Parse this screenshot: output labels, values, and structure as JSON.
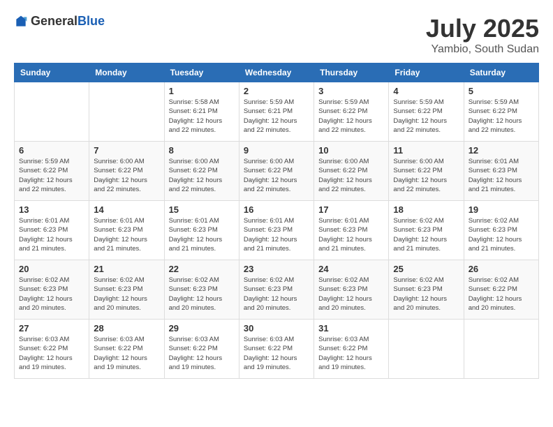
{
  "header": {
    "logo_general": "General",
    "logo_blue": "Blue",
    "title": "July 2025",
    "location": "Yambio, South Sudan"
  },
  "weekdays": [
    "Sunday",
    "Monday",
    "Tuesday",
    "Wednesday",
    "Thursday",
    "Friday",
    "Saturday"
  ],
  "weeks": [
    [
      {
        "day": "",
        "info": ""
      },
      {
        "day": "",
        "info": ""
      },
      {
        "day": "1",
        "info": "Sunrise: 5:58 AM\nSunset: 6:21 PM\nDaylight: 12 hours and 22 minutes."
      },
      {
        "day": "2",
        "info": "Sunrise: 5:59 AM\nSunset: 6:21 PM\nDaylight: 12 hours and 22 minutes."
      },
      {
        "day": "3",
        "info": "Sunrise: 5:59 AM\nSunset: 6:22 PM\nDaylight: 12 hours and 22 minutes."
      },
      {
        "day": "4",
        "info": "Sunrise: 5:59 AM\nSunset: 6:22 PM\nDaylight: 12 hours and 22 minutes."
      },
      {
        "day": "5",
        "info": "Sunrise: 5:59 AM\nSunset: 6:22 PM\nDaylight: 12 hours and 22 minutes."
      }
    ],
    [
      {
        "day": "6",
        "info": "Sunrise: 5:59 AM\nSunset: 6:22 PM\nDaylight: 12 hours and 22 minutes."
      },
      {
        "day": "7",
        "info": "Sunrise: 6:00 AM\nSunset: 6:22 PM\nDaylight: 12 hours and 22 minutes."
      },
      {
        "day": "8",
        "info": "Sunrise: 6:00 AM\nSunset: 6:22 PM\nDaylight: 12 hours and 22 minutes."
      },
      {
        "day": "9",
        "info": "Sunrise: 6:00 AM\nSunset: 6:22 PM\nDaylight: 12 hours and 22 minutes."
      },
      {
        "day": "10",
        "info": "Sunrise: 6:00 AM\nSunset: 6:22 PM\nDaylight: 12 hours and 22 minutes."
      },
      {
        "day": "11",
        "info": "Sunrise: 6:00 AM\nSunset: 6:22 PM\nDaylight: 12 hours and 22 minutes."
      },
      {
        "day": "12",
        "info": "Sunrise: 6:01 AM\nSunset: 6:23 PM\nDaylight: 12 hours and 21 minutes."
      }
    ],
    [
      {
        "day": "13",
        "info": "Sunrise: 6:01 AM\nSunset: 6:23 PM\nDaylight: 12 hours and 21 minutes."
      },
      {
        "day": "14",
        "info": "Sunrise: 6:01 AM\nSunset: 6:23 PM\nDaylight: 12 hours and 21 minutes."
      },
      {
        "day": "15",
        "info": "Sunrise: 6:01 AM\nSunset: 6:23 PM\nDaylight: 12 hours and 21 minutes."
      },
      {
        "day": "16",
        "info": "Sunrise: 6:01 AM\nSunset: 6:23 PM\nDaylight: 12 hours and 21 minutes."
      },
      {
        "day": "17",
        "info": "Sunrise: 6:01 AM\nSunset: 6:23 PM\nDaylight: 12 hours and 21 minutes."
      },
      {
        "day": "18",
        "info": "Sunrise: 6:02 AM\nSunset: 6:23 PM\nDaylight: 12 hours and 21 minutes."
      },
      {
        "day": "19",
        "info": "Sunrise: 6:02 AM\nSunset: 6:23 PM\nDaylight: 12 hours and 21 minutes."
      }
    ],
    [
      {
        "day": "20",
        "info": "Sunrise: 6:02 AM\nSunset: 6:23 PM\nDaylight: 12 hours and 20 minutes."
      },
      {
        "day": "21",
        "info": "Sunrise: 6:02 AM\nSunset: 6:23 PM\nDaylight: 12 hours and 20 minutes."
      },
      {
        "day": "22",
        "info": "Sunrise: 6:02 AM\nSunset: 6:23 PM\nDaylight: 12 hours and 20 minutes."
      },
      {
        "day": "23",
        "info": "Sunrise: 6:02 AM\nSunset: 6:23 PM\nDaylight: 12 hours and 20 minutes."
      },
      {
        "day": "24",
        "info": "Sunrise: 6:02 AM\nSunset: 6:23 PM\nDaylight: 12 hours and 20 minutes."
      },
      {
        "day": "25",
        "info": "Sunrise: 6:02 AM\nSunset: 6:23 PM\nDaylight: 12 hours and 20 minutes."
      },
      {
        "day": "26",
        "info": "Sunrise: 6:02 AM\nSunset: 6:22 PM\nDaylight: 12 hours and 20 minutes."
      }
    ],
    [
      {
        "day": "27",
        "info": "Sunrise: 6:03 AM\nSunset: 6:22 PM\nDaylight: 12 hours and 19 minutes."
      },
      {
        "day": "28",
        "info": "Sunrise: 6:03 AM\nSunset: 6:22 PM\nDaylight: 12 hours and 19 minutes."
      },
      {
        "day": "29",
        "info": "Sunrise: 6:03 AM\nSunset: 6:22 PM\nDaylight: 12 hours and 19 minutes."
      },
      {
        "day": "30",
        "info": "Sunrise: 6:03 AM\nSunset: 6:22 PM\nDaylight: 12 hours and 19 minutes."
      },
      {
        "day": "31",
        "info": "Sunrise: 6:03 AM\nSunset: 6:22 PM\nDaylight: 12 hours and 19 minutes."
      },
      {
        "day": "",
        "info": ""
      },
      {
        "day": "",
        "info": ""
      }
    ]
  ]
}
